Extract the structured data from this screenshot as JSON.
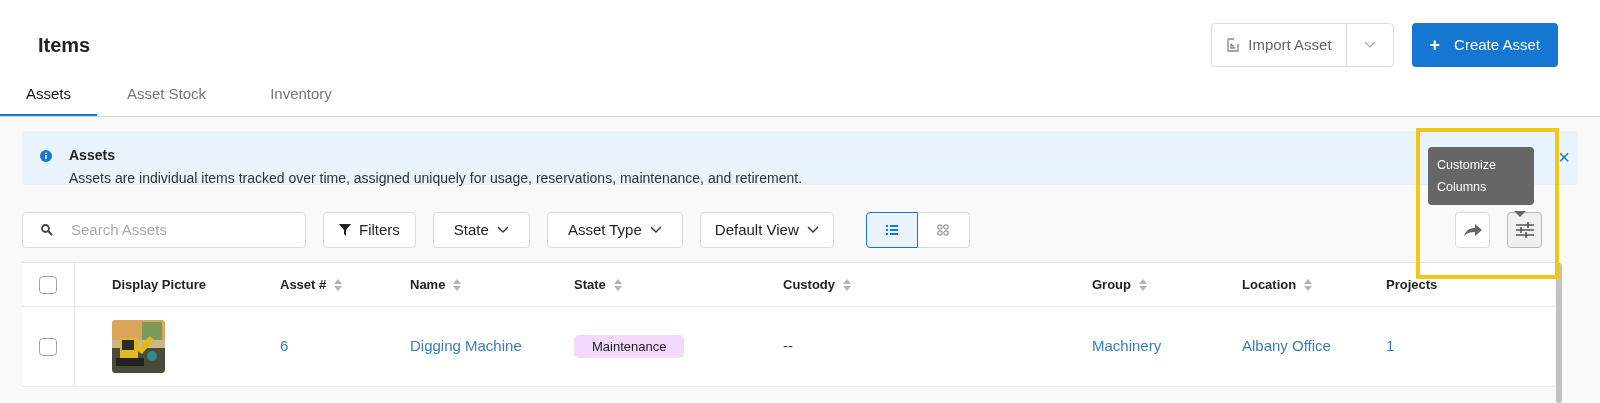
{
  "page_title": "Items",
  "header_buttons": {
    "import": "Import Asset",
    "create": "Create Asset",
    "create_icon": "+"
  },
  "tabs": [
    {
      "label": "Assets",
      "selected": true
    },
    {
      "label": "Asset Stock",
      "selected": false
    },
    {
      "label": "Inventory",
      "selected": false
    }
  ],
  "banner": {
    "title": "Assets",
    "text": "Assets are individual items tracked over time, assigned uniquely for usage, reservations, maintenance, and retirement.",
    "close": "×"
  },
  "toolbar": {
    "search_placeholder": "Search Assets",
    "filters": "Filters",
    "dropdowns": [
      "State",
      "Asset Type",
      "Default View"
    ],
    "views": [
      {
        "kind": "list",
        "selected": true
      },
      {
        "kind": "grid",
        "selected": false
      }
    ]
  },
  "tooltip": "Customize Columns",
  "table": {
    "select_all_checked": false,
    "columns": [
      {
        "label": "Display Picture",
        "sortable": false
      },
      {
        "label": "Asset #",
        "sortable": true
      },
      {
        "label": "Name",
        "sortable": true
      },
      {
        "label": "State",
        "sortable": true
      },
      {
        "label": "Custody",
        "sortable": true
      },
      {
        "label": "Group",
        "sortable": true
      },
      {
        "label": "Location",
        "sortable": true
      },
      {
        "label": "Projects",
        "sortable": false
      }
    ],
    "rows": [
      {
        "checked": false,
        "asset_no": "6",
        "name": "Digging Machine",
        "state": {
          "label": "Maintenance",
          "color": "#f3d9fb"
        },
        "custody": "--",
        "group": "Machinery",
        "location": "Albany Office",
        "projects": "1"
      }
    ]
  }
}
